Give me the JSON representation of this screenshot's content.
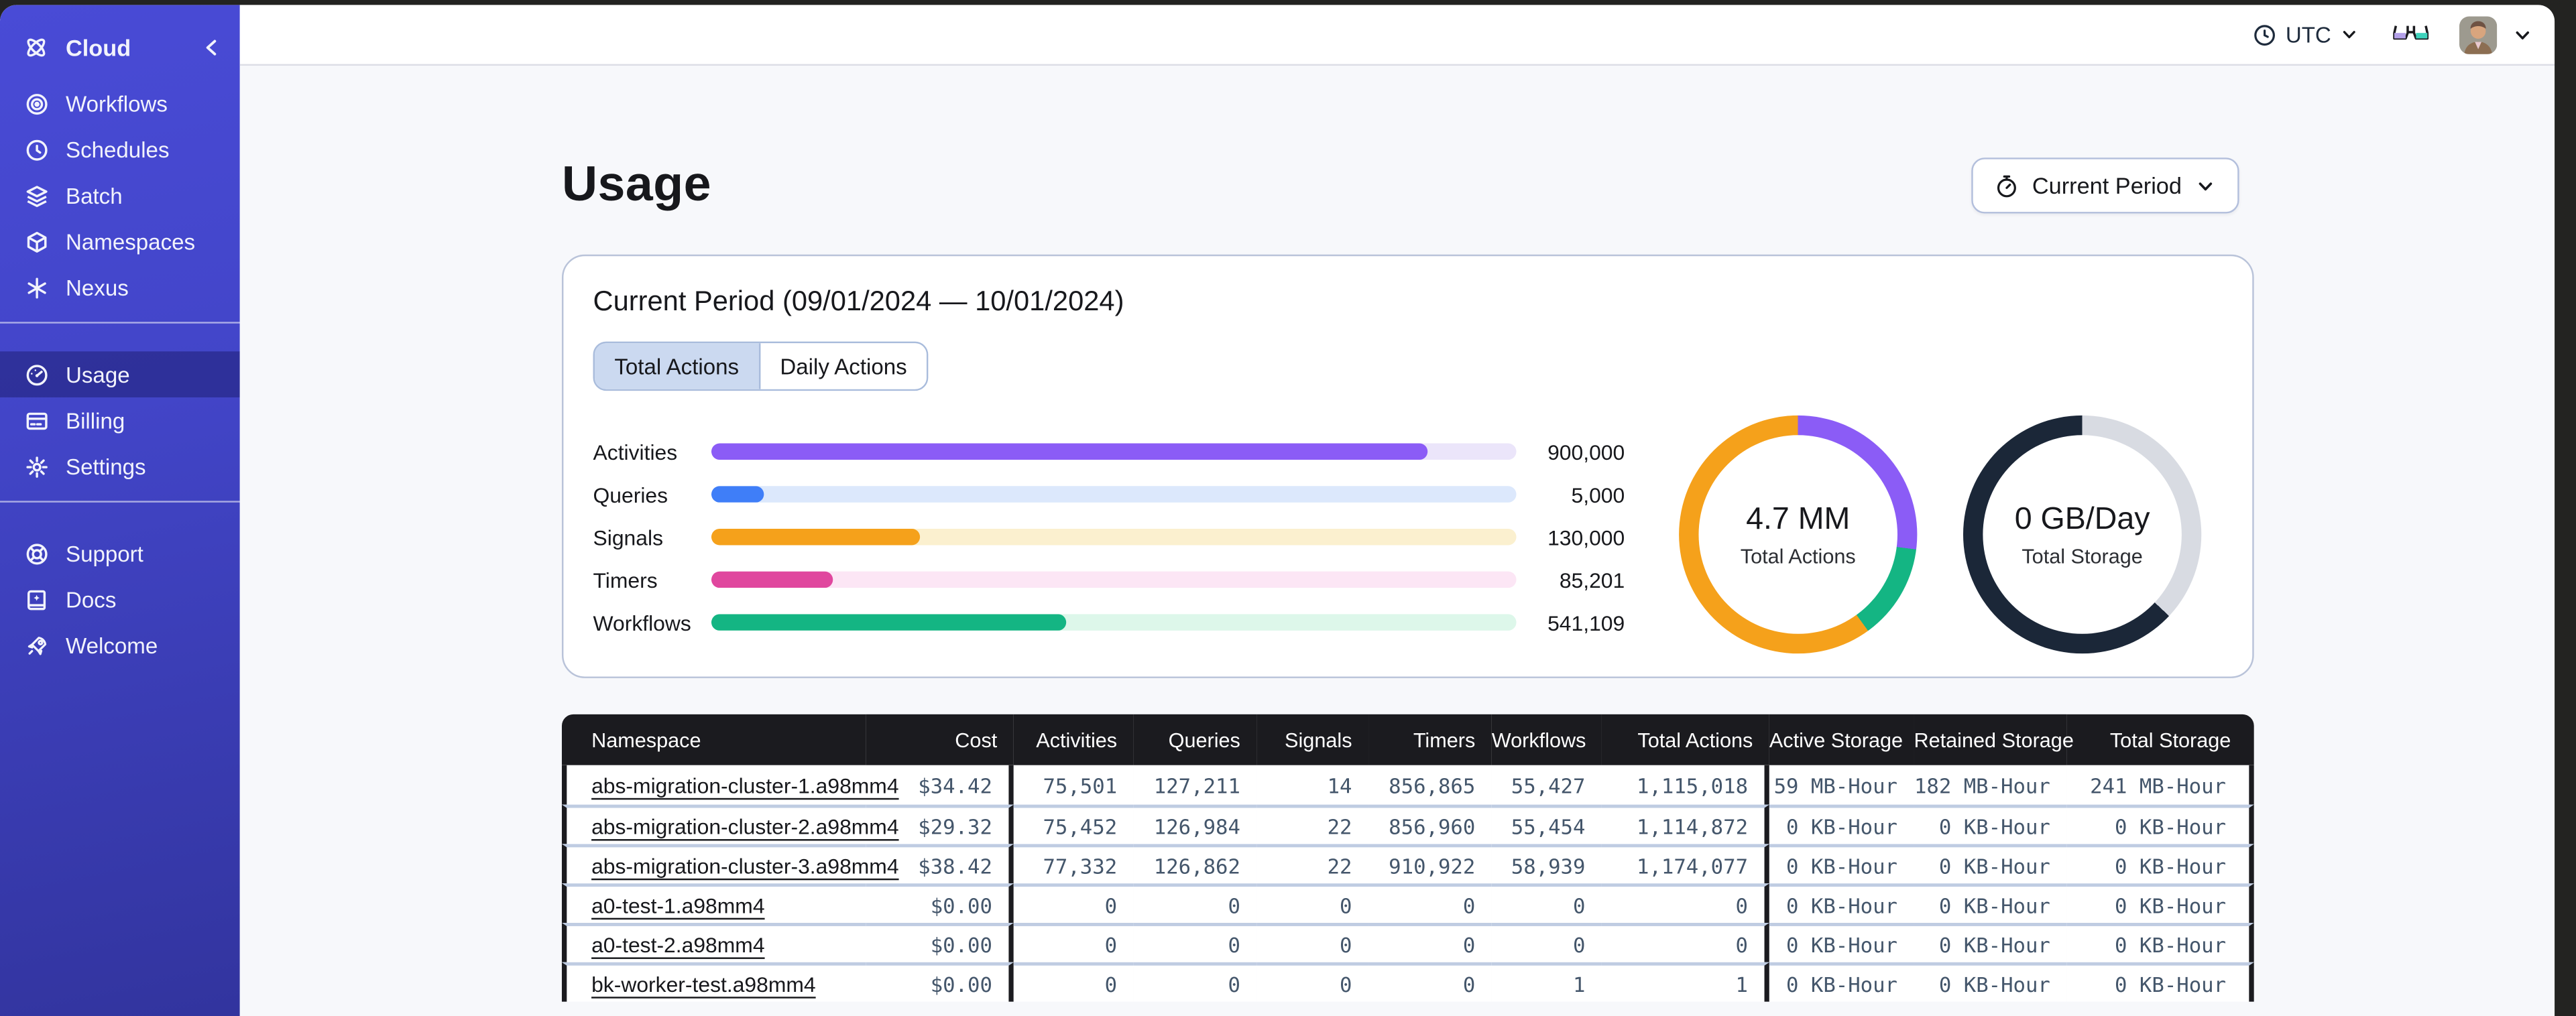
{
  "sidebar": {
    "brand": {
      "label": "Cloud"
    },
    "nav_main": [
      {
        "icon": "workflows-icon",
        "label": "Workflows"
      },
      {
        "icon": "schedules-icon",
        "label": "Schedules"
      },
      {
        "icon": "batch-icon",
        "label": "Batch"
      },
      {
        "icon": "namespaces-icon",
        "label": "Namespaces"
      },
      {
        "icon": "nexus-icon",
        "label": "Nexus"
      }
    ],
    "nav_account": [
      {
        "icon": "usage-icon",
        "label": "Usage",
        "active": true
      },
      {
        "icon": "billing-icon",
        "label": "Billing"
      },
      {
        "icon": "settings-icon",
        "label": "Settings"
      }
    ],
    "nav_help": [
      {
        "icon": "support-icon",
        "label": "Support"
      },
      {
        "icon": "docs-icon",
        "label": "Docs"
      },
      {
        "icon": "welcome-icon",
        "label": "Welcome"
      }
    ]
  },
  "topbar": {
    "timezone": "UTC"
  },
  "page": {
    "title": "Usage",
    "period_button_label": "Current Period"
  },
  "usage_card": {
    "title": "Current Period (09/01/2024 — 10/01/2024)",
    "tabs": [
      {
        "label": "Total Actions",
        "active": true
      },
      {
        "label": "Daily Actions",
        "active": false
      }
    ],
    "bars": [
      {
        "label": "Activities",
        "value": "900,000",
        "percent": 89,
        "color": "#8B5CF6",
        "track_color": "#EBE5FA"
      },
      {
        "label": "Queries",
        "value": "5,000",
        "percent": 6.5,
        "color": "#3F7EF8",
        "track_color": "#DCE8FC"
      },
      {
        "label": "Signals",
        "value": "130,000",
        "percent": 26,
        "color": "#F5A11B",
        "track_color": "#FBF0CF"
      },
      {
        "label": "Timers",
        "value": "85,201",
        "percent": 15,
        "color": "#E0479E",
        "track_color": "#FCE6F5"
      },
      {
        "label": "Workflows",
        "value": "541,109",
        "percent": 44,
        "color": "#14B583",
        "track_color": "#DDF7EA"
      }
    ],
    "donuts": [
      {
        "value": "4.7 MM",
        "label": "Total Actions",
        "segments": [
          {
            "color": "#8B5CF6",
            "percent": 27
          },
          {
            "color": "#14B583",
            "percent": 13
          },
          {
            "color": "#F5A11B",
            "percent": 60
          }
        ]
      },
      {
        "value": "0 GB/Day",
        "label": "Total Storage",
        "segments": [
          {
            "color": "#D8DBE2",
            "percent": 37
          },
          {
            "color": "#1B2738",
            "percent": 63
          }
        ]
      }
    ]
  },
  "table": {
    "columns": [
      "Namespace",
      "Cost",
      "Activities",
      "Queries",
      "Signals",
      "Timers",
      "Workflows",
      "Total Actions",
      "Active Storage",
      "Retained Storage",
      "Total Storage"
    ],
    "rows": [
      {
        "namespace": "abs-migration-cluster-1.a98mm4",
        "cost": "$34.42",
        "activities": "75,501",
        "queries": "127,211",
        "signals": "14",
        "timers": "856,865",
        "workflows": "55,427",
        "total_actions": "1,115,018",
        "active_storage": "59 MB-Hour",
        "retained_storage": "182 MB-Hour",
        "total_storage": "241 MB-Hour"
      },
      {
        "namespace": "abs-migration-cluster-2.a98mm4",
        "cost": "$29.32",
        "activities": "75,452",
        "queries": "126,984",
        "signals": "22",
        "timers": "856,960",
        "workflows": "55,454",
        "total_actions": "1,114,872",
        "active_storage": "0 KB-Hour",
        "retained_storage": "0 KB-Hour",
        "total_storage": "0 KB-Hour"
      },
      {
        "namespace": "abs-migration-cluster-3.a98mm4",
        "cost": "$38.42",
        "activities": "77,332",
        "queries": "126,862",
        "signals": "22",
        "timers": "910,922",
        "workflows": "58,939",
        "total_actions": "1,174,077",
        "active_storage": "0 KB-Hour",
        "retained_storage": "0 KB-Hour",
        "total_storage": "0 KB-Hour"
      },
      {
        "namespace": "a0-test-1.a98mm4",
        "cost": "$0.00",
        "activities": "0",
        "queries": "0",
        "signals": "0",
        "timers": "0",
        "workflows": "0",
        "total_actions": "0",
        "active_storage": "0 KB-Hour",
        "retained_storage": "0 KB-Hour",
        "total_storage": "0 KB-Hour"
      },
      {
        "namespace": "a0-test-2.a98mm4",
        "cost": "$0.00",
        "activities": "0",
        "queries": "0",
        "signals": "0",
        "timers": "0",
        "workflows": "0",
        "total_actions": "0",
        "active_storage": "0 KB-Hour",
        "retained_storage": "0 KB-Hour",
        "total_storage": "0 KB-Hour"
      },
      {
        "namespace": "bk-worker-test.a98mm4",
        "cost": "$0.00",
        "activities": "0",
        "queries": "0",
        "signals": "0",
        "timers": "0",
        "workflows": "1",
        "total_actions": "1",
        "active_storage": "0 KB-Hour",
        "retained_storage": "0 KB-Hour",
        "total_storage": "0 KB-Hour"
      }
    ]
  }
}
